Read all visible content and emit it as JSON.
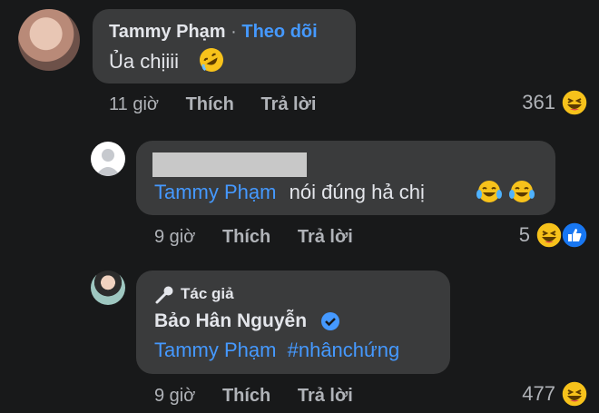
{
  "comment1": {
    "author": "Tammy Phạm",
    "separator": "·",
    "follow": "Theo dõi",
    "text": "Ủa chịiii",
    "time": "11 giờ",
    "like": "Thích",
    "reply": "Trả lời",
    "reaction_count": "361",
    "emoji_icon": "rolling-laugh-emoji",
    "reaction_icon": "haha-reaction-icon"
  },
  "comment2": {
    "mention": "Tammy Phạm",
    "text": "nói đúng hả chị",
    "time": "9 giờ",
    "like": "Thích",
    "reply": "Trả lời",
    "reaction_count": "5",
    "emoji_icons": [
      "tears-of-joy-emoji",
      "tears-of-joy-emoji"
    ],
    "reaction_icons": [
      "haha-reaction-icon",
      "like-reaction-icon"
    ]
  },
  "comment3": {
    "badge": "Tác giả",
    "author": "Bảo Hân Nguyễn",
    "mention": "Tammy Phạm",
    "hashtag": "#nhânchứng",
    "time": "9 giờ",
    "like": "Thích",
    "reply": "Trả lời",
    "reaction_count": "477",
    "reaction_icon": "haha-reaction-icon"
  },
  "colors": {
    "background": "#18191a",
    "bubble": "#3a3b3c",
    "link": "#4599ff",
    "muted": "#b0b3b8",
    "verified": "#4599ff"
  }
}
